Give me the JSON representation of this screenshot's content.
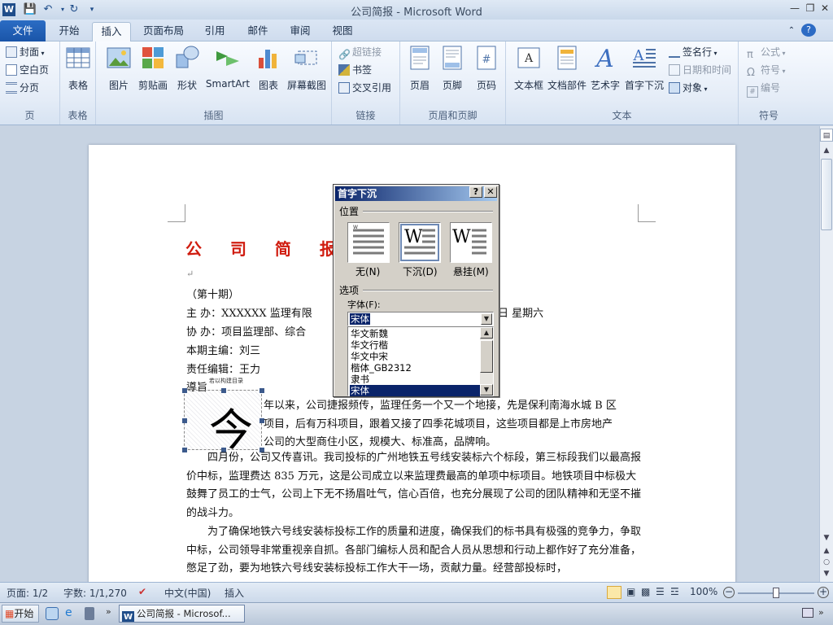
{
  "window": {
    "title": "公司简报  -  Microsoft Word"
  },
  "tabs": {
    "file": "文件",
    "home": "开始",
    "insert": "插入",
    "layout": "页面布局",
    "references": "引用",
    "mailings": "邮件",
    "review": "审阅",
    "view": "视图"
  },
  "ribbon": {
    "pages": {
      "label": "页",
      "cover": "封面",
      "blank": "空白页",
      "break": "分页"
    },
    "tables": {
      "label": "表格",
      "table": "表格"
    },
    "illustrations": {
      "label": "插图",
      "picture": "图片",
      "clipart": "剪贴画",
      "shapes": "形状",
      "smartart": "SmartArt",
      "chart": "图表",
      "screenshot": "屏幕截图"
    },
    "links": {
      "label": "链接",
      "hyperlink": "超链接",
      "bookmark": "书签",
      "crossref": "交叉引用"
    },
    "headerfooter": {
      "label": "页眉和页脚",
      "header": "页眉",
      "footer": "页脚",
      "pagenum": "页码"
    },
    "text": {
      "label": "文本",
      "textbox": "文本框",
      "quickparts": "文档部件",
      "wordart": "艺术字",
      "dropcap": "首字下沉",
      "signature": "签名行",
      "datetime": "日期和时间",
      "object": "对象"
    },
    "symbols": {
      "label": "符号",
      "equation": "公式",
      "symbol": "符号",
      "number": "编号"
    }
  },
  "doc": {
    "title": "公 司 简 报",
    "issue": "（第十期）",
    "host": "主      办：XXXXXX 监理有限",
    "host_tail": "日     星期六",
    "cohost": "协      办：项目监理部、综合",
    "editor": "本期主编：刘三",
    "resp": "责任编辑：王力",
    "lead": "導旨",
    "lead_small": "若以构建目录",
    "dropcap": "今",
    "p1_l1": "年以来，公司捷报频传，监理任务一个又一个地接，先是保利南海水城 B 区",
    "p1_l2": "项目，后有万科项目，跟着又接了四季花城项目，这些项目都是上市房地产",
    "p1_l3": "公司的大型商住小区，规模大、标准高，品牌响。",
    "p2": "四月份，公司又传喜讯。我司投标的广州地铁五号线安装标六个标段，第三标段我们以最高报价中标，监理费达 835 万元，这是公司成立以来监理费最高的单项中标项目。地铁项目中标极大鼓舞了员工的士气，公司上下无不扬眉吐气，信心百倍，也充分展现了公司的团队精神和无坚不摧的战斗力。",
    "p3": "为了确保地铁六号线安装标投标工作的质量和进度，确保我们的标书具有极强的竞争力，争取中标，公司领导非常重视亲自抓。各部门编标人员和配合人员从思想和行动上都作好了充分准备，憋足了劲，要为地铁六号线安装标投标工作大干一场，贡献力量。经营部投标时，"
  },
  "dialog": {
    "title": "首字下沉",
    "help": "?",
    "close": "✕",
    "position_label": "位置",
    "opt_none": "无(N)",
    "opt_drop": "下沉(D)",
    "opt_margin": "悬挂(M)",
    "options_label": "选项",
    "font_label": "字体(F):",
    "font_value": "宋体",
    "font_list": [
      "华文新魏",
      "华文行楷",
      "华文中宋",
      "楷体_GB2312",
      "隶书",
      "宋体"
    ]
  },
  "status": {
    "page": "页面: 1/2",
    "words": "字数: 1/1,270",
    "lang": "中文(中国)",
    "mode": "插入",
    "zoom": "100%"
  },
  "taskbar": {
    "start": "开始",
    "task": "公司简报 - Microsof..."
  },
  "colors": {
    "title_red": "#d01d10",
    "dialog_caption": "#0a246a",
    "file_tab": "#1a55a8"
  }
}
